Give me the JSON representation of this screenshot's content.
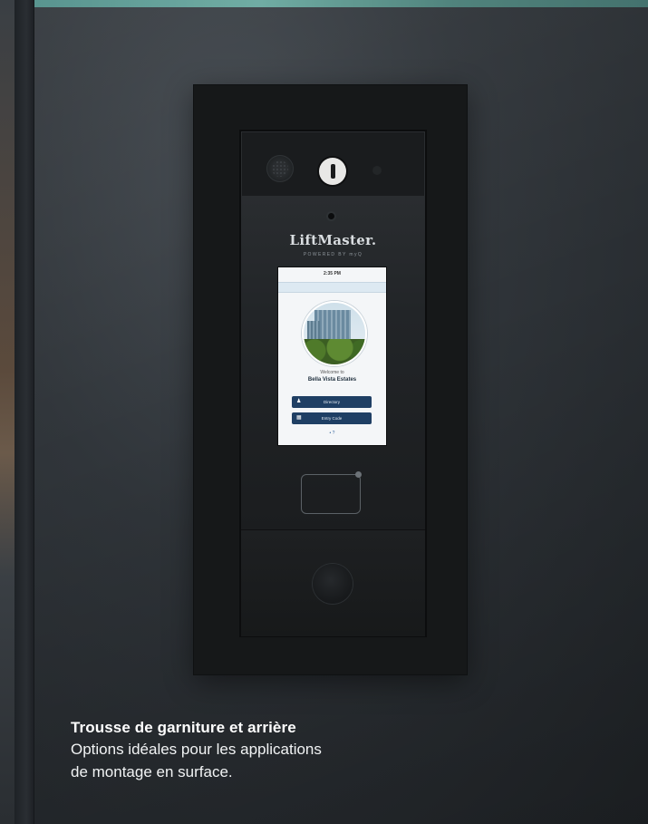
{
  "caption": {
    "title": "Trousse de garniture et arrière",
    "line1": "Options idéales pour les applications",
    "line2": "de montage en surface."
  },
  "device": {
    "brand": "LiftMaster.",
    "brand_sub": "POWERED BY myQ",
    "screen": {
      "time": "2:35 PM",
      "welcome": "Welcome to",
      "property_name": "Bella Vista Estates",
      "buttons": [
        {
          "label": "Directory",
          "icon": "person-icon"
        },
        {
          "label": "Entry Code",
          "icon": "keypad-icon"
        }
      ],
      "footer_icon": "help-icon"
    }
  },
  "colors": {
    "wall": "#2b2f33",
    "trim": "#161819",
    "screen_button": "#1f3f64",
    "caption_text": "#ffffff"
  }
}
